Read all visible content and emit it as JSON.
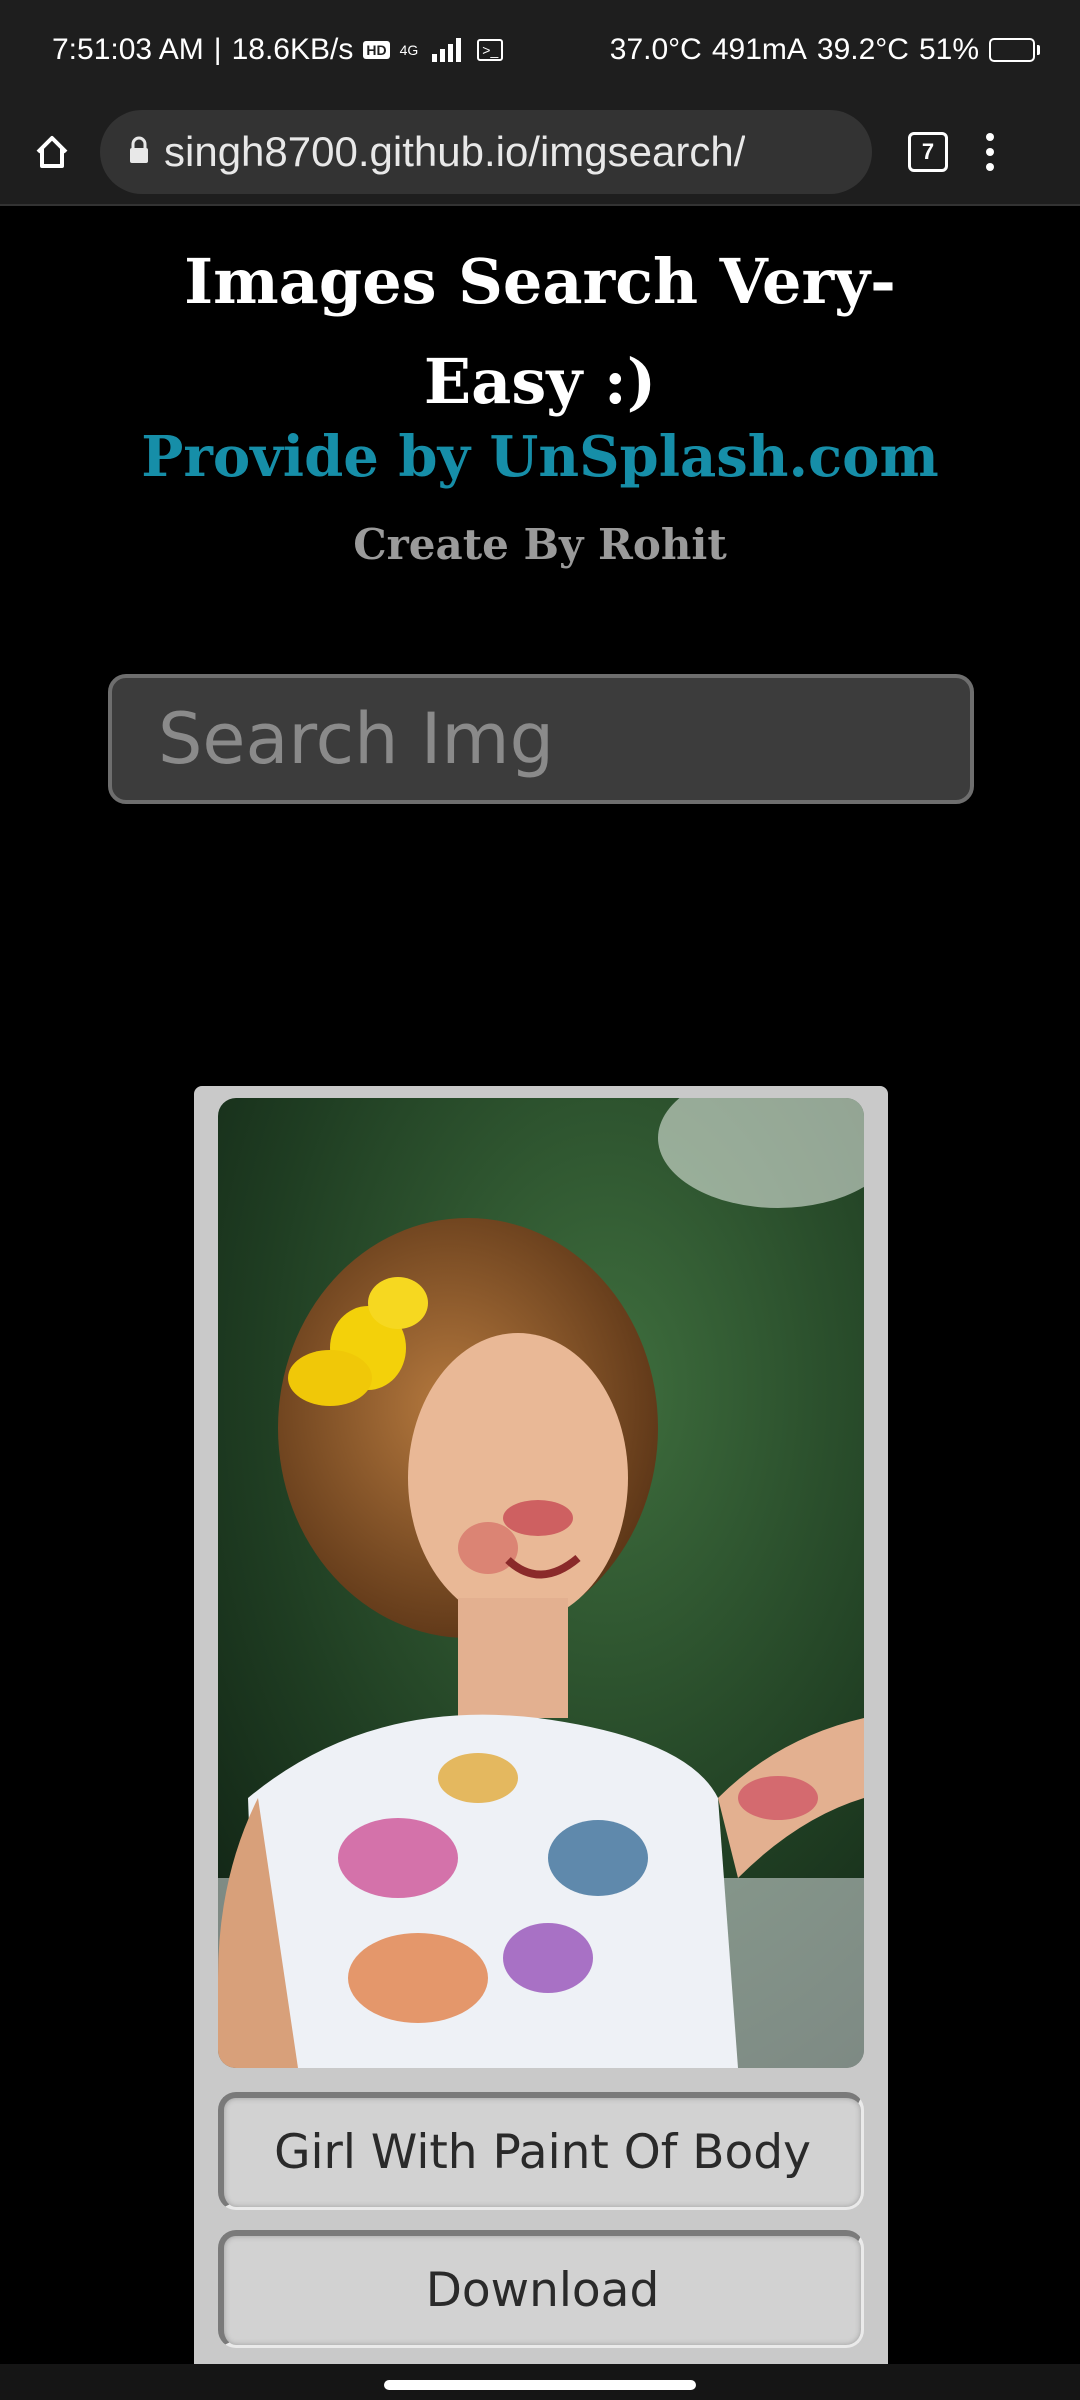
{
  "status_bar": {
    "time": "7:51:03 AM",
    "net_speed": "18.6KB/s",
    "hd_badge": "HD",
    "network_type": "4G",
    "temp1": "37.0°C",
    "current": "491mA",
    "temp2": "39.2°C",
    "battery_percent": "51%",
    "battery_level": 0.51
  },
  "browser": {
    "url": "singh8700.github.io/imgsearch/",
    "tab_count": "7",
    "icons": [
      "home-icon",
      "lock-icon",
      "tabs-icon",
      "overflow-menu-icon"
    ]
  },
  "page": {
    "title_line1": "Images Search Very-",
    "title_line2": "Easy :)",
    "subtitle": "Provide by UnSplash.com",
    "author": "Create By Rohit",
    "search_placeholder": "Search Img"
  },
  "result": {
    "caption": "Girl With Paint Of Body",
    "download_label": "Download"
  },
  "colors": {
    "subtitle": "#168ea8",
    "author": "#9a9a9a",
    "card_bg": "#c9c9c9",
    "bar_bg": "#1e1e1e"
  }
}
